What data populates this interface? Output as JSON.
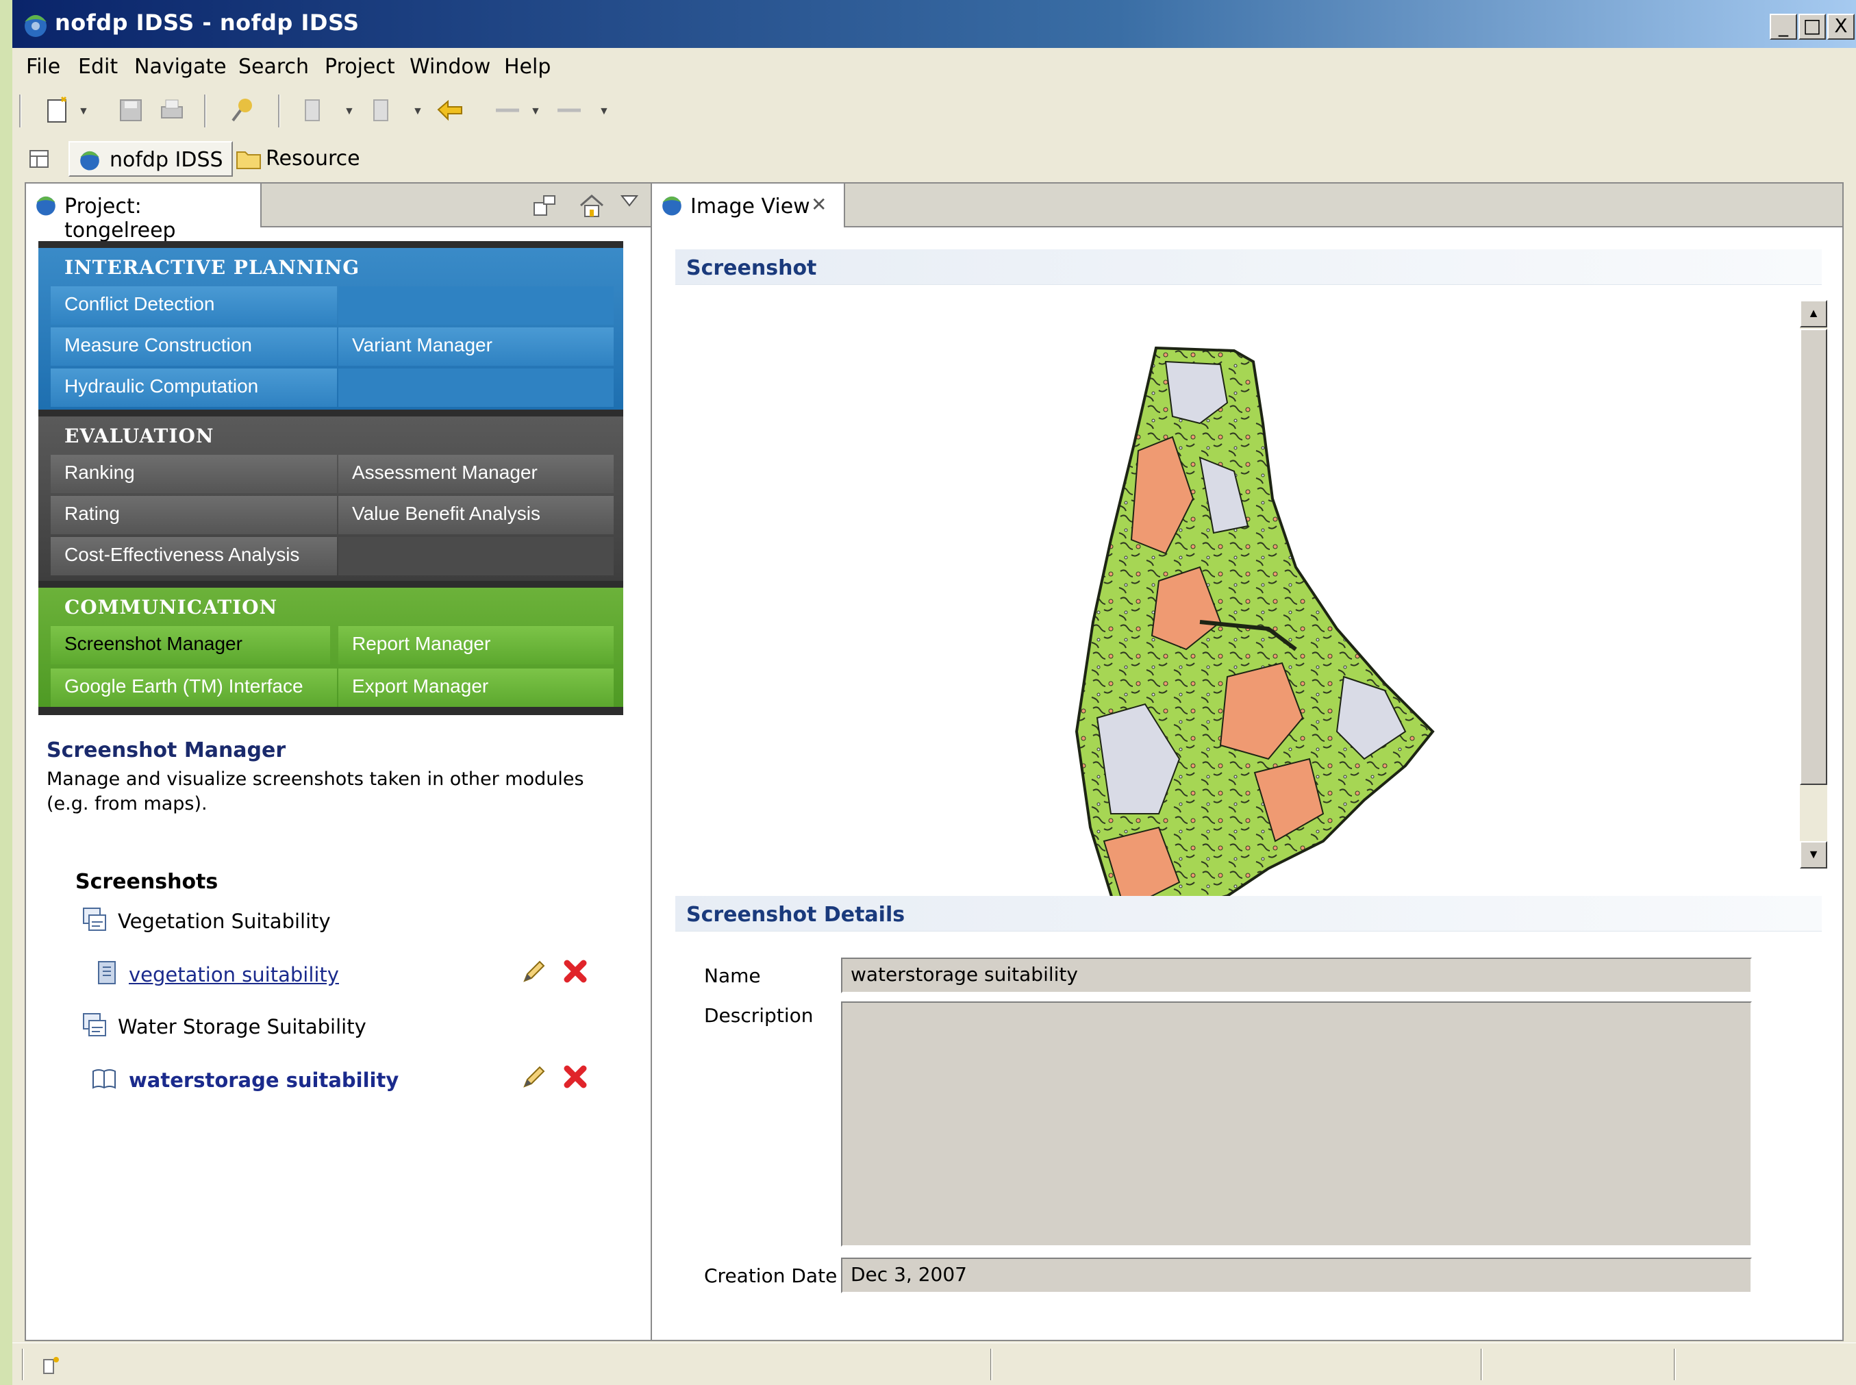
{
  "window": {
    "title": "nofdp IDSS - nofdp IDSS",
    "minimize": "_",
    "maximize": "□",
    "close": "X"
  },
  "menu": [
    "File",
    "Edit",
    "Navigate",
    "Search",
    "Project",
    "Window",
    "Help"
  ],
  "perspectives": [
    "nofdp IDSS",
    "Resource"
  ],
  "left_view": {
    "tab": "Project: tongelreep",
    "sections": [
      {
        "title": "INTERACTIVE PLANNING",
        "items": [
          "Conflict Detection",
          "Measure Construction",
          "Variant Manager",
          "Hydraulic Computation"
        ]
      },
      {
        "title": "EVALUATION",
        "items": [
          "Ranking",
          "Assessment Manager",
          "Rating",
          "Value Benefit Analysis",
          "Cost-Effectiveness Analysis"
        ]
      },
      {
        "title": "COMMUNICATION",
        "items": [
          "Screenshot Manager",
          "Report Manager",
          "Google Earth (TM) Interface",
          "Export Manager"
        ]
      }
    ],
    "module_title": "Screenshot Manager",
    "module_desc_1": "Manage and visualize screenshots taken in other modules",
    "module_desc_2": "(e.g. from maps).",
    "screenshots_title": "Screenshots",
    "groups": [
      {
        "label": "Vegetation Suitability",
        "item": "vegetation suitability"
      },
      {
        "label": "Water Storage Suitability",
        "item": "waterstorage suitability"
      }
    ]
  },
  "right_view": {
    "tab": "Image View",
    "screenshot_header": "Screenshot",
    "details_header": "Screenshot Details",
    "name_label": "Name",
    "name_value": "waterstorage suitability",
    "description_label": "Description",
    "description_value": "",
    "date_label": "Creation Date",
    "date_value": "Dec 3, 2007"
  },
  "colors": {
    "planning": "#2f82c2",
    "evaluation": "#4b4b4b",
    "communication": "#5ca82e",
    "map_green": "#a6d654",
    "map_salmon": "#ef9a72",
    "map_grey": "#d9dbe6"
  }
}
